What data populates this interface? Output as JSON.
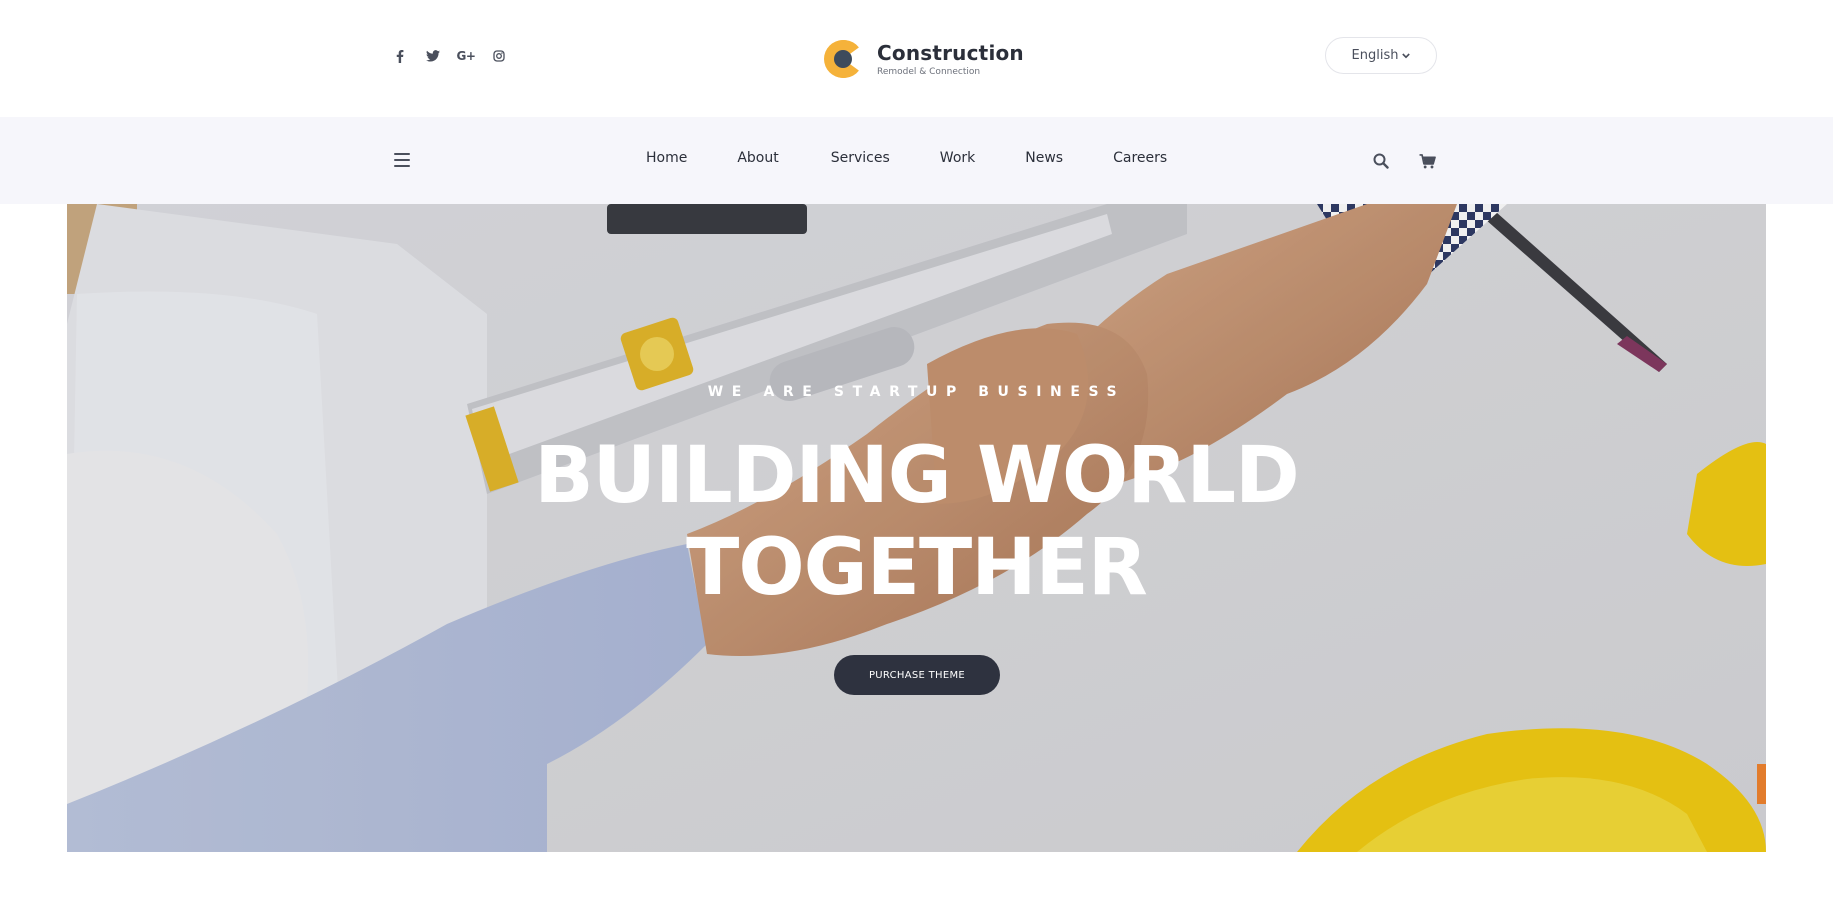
{
  "header": {
    "social": [
      {
        "name": "facebook-icon"
      },
      {
        "name": "twitter-icon"
      },
      {
        "name": "google-plus-icon",
        "glyph": "G+"
      },
      {
        "name": "instagram-icon"
      }
    ],
    "logo": {
      "title": "Construction",
      "subtitle": "Remodel & Connection",
      "mark_color": "#f5b23a",
      "mark_inner_color": "#3d4b5c"
    },
    "language": {
      "selected": "English"
    }
  },
  "nav": {
    "items": [
      {
        "label": "Home"
      },
      {
        "label": "About"
      },
      {
        "label": "Services"
      },
      {
        "label": "Work"
      },
      {
        "label": "News"
      },
      {
        "label": "Careers"
      }
    ],
    "icons": [
      "search-icon",
      "cart-icon"
    ]
  },
  "hero": {
    "tagline": "WE ARE STARTUP BUSINESS",
    "headline_line1": "BUILDING WORLD",
    "headline_line2": "TOGETHER",
    "cta_label": "PURCHASE THEME",
    "cta_color": "#2e323f"
  },
  "colors": {
    "accent": "#f5b23a",
    "nav_bg": "#f6f6fb",
    "text_dark": "#2b2f3a"
  }
}
